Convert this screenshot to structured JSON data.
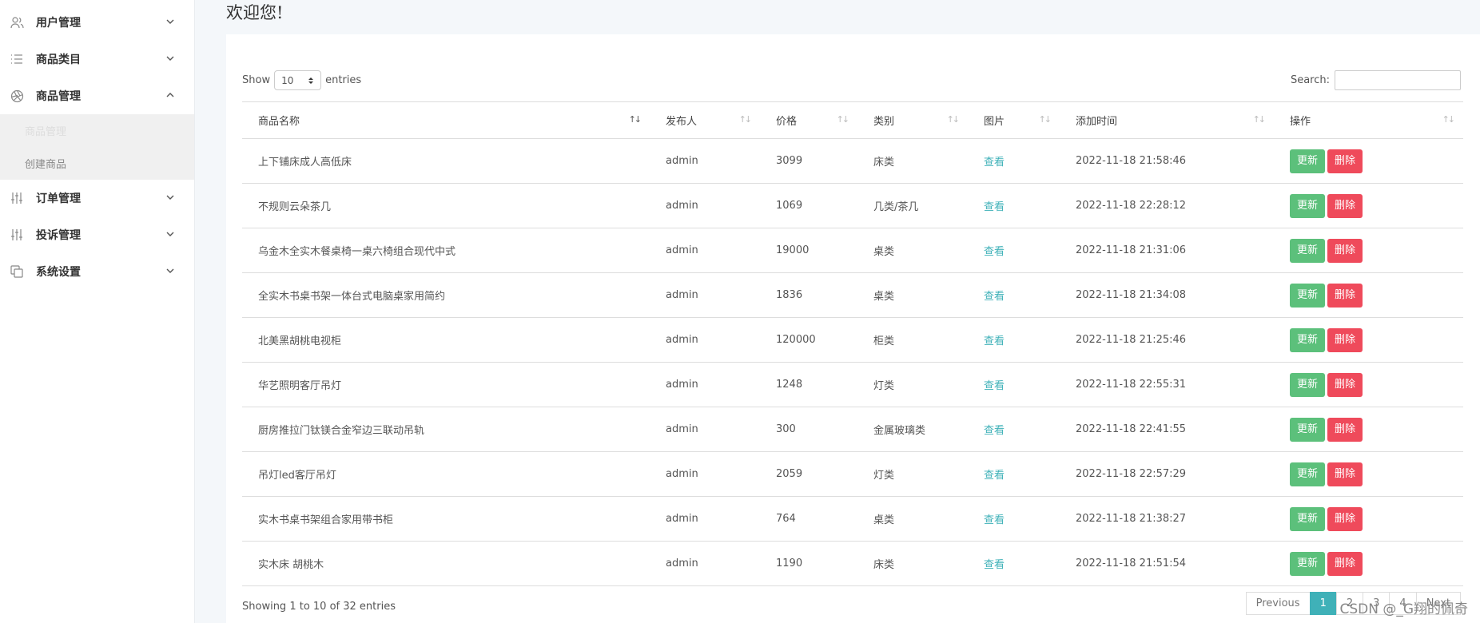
{
  "sidebar": {
    "items": [
      {
        "label": "用户管理",
        "icon": "users-icon",
        "expanded": false
      },
      {
        "label": "商品类目",
        "icon": "list-icon",
        "expanded": false
      },
      {
        "label": "商品管理",
        "icon": "aperture-icon",
        "expanded": true
      },
      {
        "label": "订单管理",
        "icon": "sliders-icon",
        "expanded": false
      },
      {
        "label": "投诉管理",
        "icon": "sliders-icon",
        "expanded": false
      },
      {
        "label": "系统设置",
        "icon": "copy-icon",
        "expanded": false
      }
    ],
    "submenu": [
      {
        "label": "商品管理",
        "active": true
      },
      {
        "label": "创建商品",
        "active": false
      }
    ]
  },
  "header": {
    "welcome": "欢迎您!"
  },
  "controls": {
    "show_label": "Show",
    "entries_label": "entries",
    "page_length": "10",
    "search_label": "Search:",
    "search_value": ""
  },
  "table": {
    "columns": [
      "商品名称",
      "发布人",
      "价格",
      "类别",
      "图片",
      "添加时间",
      "操作"
    ],
    "rows": [
      {
        "name": "上下铺床成人高低床",
        "publisher": "admin",
        "price": "3099",
        "category": "床类",
        "image": "查看",
        "time": "2022-11-18 21:58:46"
      },
      {
        "name": "不规则云朵茶几",
        "publisher": "admin",
        "price": "1069",
        "category": "几类/茶几",
        "image": "查看",
        "time": "2022-11-18 22:28:12"
      },
      {
        "name": "乌金木全实木餐桌椅一桌六椅组合现代中式",
        "publisher": "admin",
        "price": "19000",
        "category": "桌类",
        "image": "查看",
        "time": "2022-11-18 21:31:06"
      },
      {
        "name": "全实木书桌书架一体台式电脑桌家用简约",
        "publisher": "admin",
        "price": "1836",
        "category": "桌类",
        "image": "查看",
        "time": "2022-11-18 21:34:08"
      },
      {
        "name": "北美黑胡桃电视柜",
        "publisher": "admin",
        "price": "120000",
        "category": "柜类",
        "image": "查看",
        "time": "2022-11-18 21:25:46"
      },
      {
        "name": "华艺照明客厅吊灯",
        "publisher": "admin",
        "price": "1248",
        "category": "灯类",
        "image": "查看",
        "time": "2022-11-18 22:55:31"
      },
      {
        "name": "厨房推拉门钛镁合金窄边三联动吊轨",
        "publisher": "admin",
        "price": "300",
        "category": "金属玻璃类",
        "image": "查看",
        "time": "2022-11-18 22:41:55"
      },
      {
        "name": "吊灯led客厅吊灯",
        "publisher": "admin",
        "price": "2059",
        "category": "灯类",
        "image": "查看",
        "time": "2022-11-18 22:57:29"
      },
      {
        "name": "实木书桌书架组合家用带书柜",
        "publisher": "admin",
        "price": "764",
        "category": "桌类",
        "image": "查看",
        "time": "2022-11-18 21:38:27"
      },
      {
        "name": "实木床 胡桃木",
        "publisher": "admin",
        "price": "1190",
        "category": "床类",
        "image": "查看",
        "time": "2022-11-18 21:51:54"
      }
    ],
    "update_label": "更新",
    "delete_label": "删除"
  },
  "footer": {
    "info": "Showing 1 to 10 of 32 entries",
    "pagination": [
      "Previous",
      "1",
      "2",
      "3",
      "4",
      "Next"
    ],
    "current_page": "1"
  },
  "watermark": "CSDN @_G翔的佩奇",
  "colors": {
    "accent": "#3fb1b8",
    "update": "#5cc07b",
    "delete": "#ef4a5b"
  }
}
